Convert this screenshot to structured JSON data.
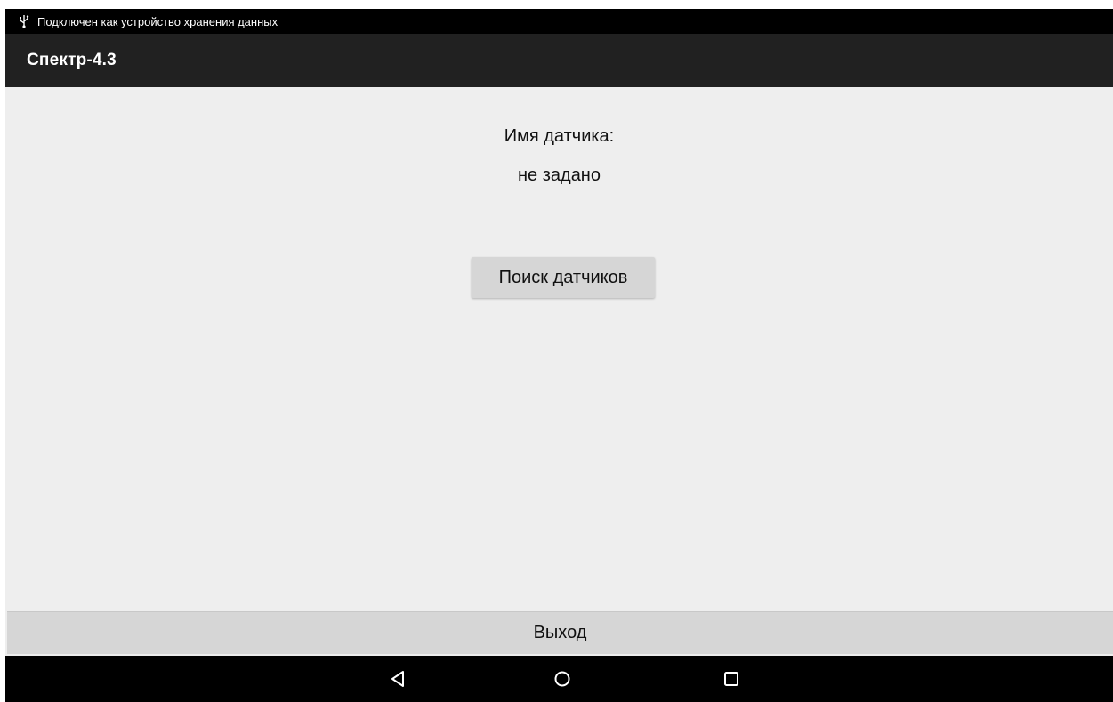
{
  "status_bar": {
    "usb_icon": "usb-icon",
    "text": "Подключен как устройство хранения данных"
  },
  "action_bar": {
    "title": "Спектр-4.3"
  },
  "main": {
    "sensor_name_label": "Имя датчика:",
    "sensor_name_value": "не задано",
    "search_button_label": "Поиск датчиков"
  },
  "footer": {
    "exit_button_label": "Выход"
  },
  "nav_bar": {
    "back_icon": "back-icon",
    "home_icon": "home-icon",
    "recents_icon": "recents-icon"
  },
  "colors": {
    "status_bar": "#000000",
    "action_bar": "#212121",
    "background": "#eeeeee",
    "button": "#d6d6d6"
  }
}
